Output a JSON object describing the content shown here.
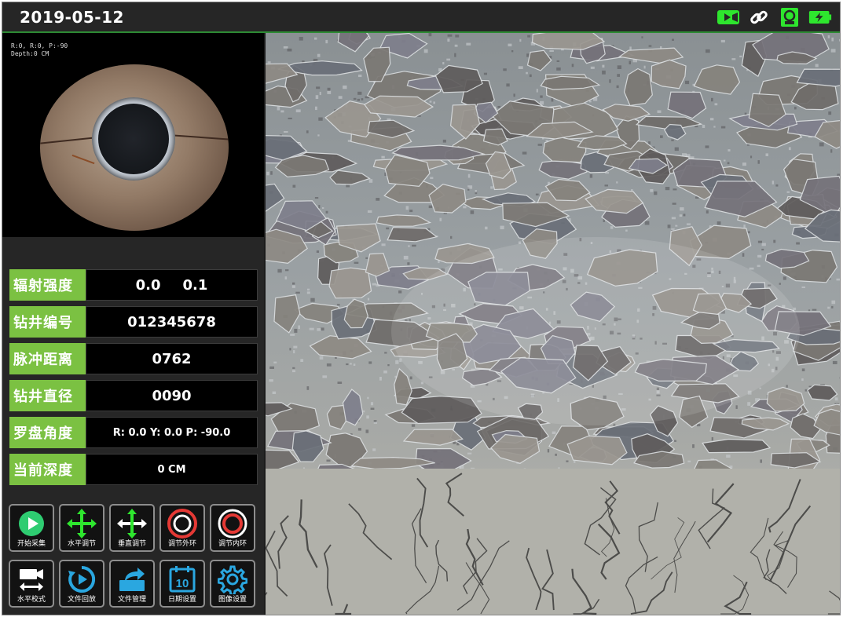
{
  "header": {
    "date": "2019-05-12",
    "icons": [
      "video-camera-icon",
      "link-icon",
      "record-icon",
      "battery-charging-icon"
    ],
    "accent": "#2ee62e"
  },
  "camera": {
    "osd_line1": "R:0, R:0, P:-90",
    "osd_line2": "Depth:0 CM"
  },
  "fields": [
    {
      "label": "辐射强度",
      "value_a": "0.0",
      "value_b": "0.1"
    },
    {
      "label": "钻井编号",
      "value": "012345678"
    },
    {
      "label": "脉冲距离",
      "value": "0762"
    },
    {
      "label": "钻井直径",
      "value": "0090"
    },
    {
      "label": "罗盘角度",
      "value": "R: 0.0 Y: 0.0 P: -90.0"
    },
    {
      "label": "当前深度",
      "value": "0 CM"
    }
  ],
  "buttons_row1": [
    {
      "label": "开始采集",
      "icon": "play-icon"
    },
    {
      "label": "水平调节",
      "icon": "move-arrows-icon"
    },
    {
      "label": "垂直调节",
      "icon": "move-arrows-icon"
    },
    {
      "label": "调节外环",
      "icon": "outer-ring-icon"
    },
    {
      "label": "调节内环",
      "icon": "inner-ring-icon"
    }
  ],
  "buttons_row2": [
    {
      "label": "水平校式",
      "icon": "camera-level-icon"
    },
    {
      "label": "文件回放",
      "icon": "replay-icon"
    },
    {
      "label": "文件管理",
      "icon": "folder-share-icon"
    },
    {
      "label": "日期设置",
      "icon": "calendar-icon",
      "calendar_day": "10"
    },
    {
      "label": "图像设置",
      "icon": "gear-icon"
    }
  ],
  "colors": {
    "label_green": "#7bc142",
    "icon_green": "#2ee62e",
    "icon_blue": "#2aa7e0",
    "ring_red": "#e53935"
  }
}
